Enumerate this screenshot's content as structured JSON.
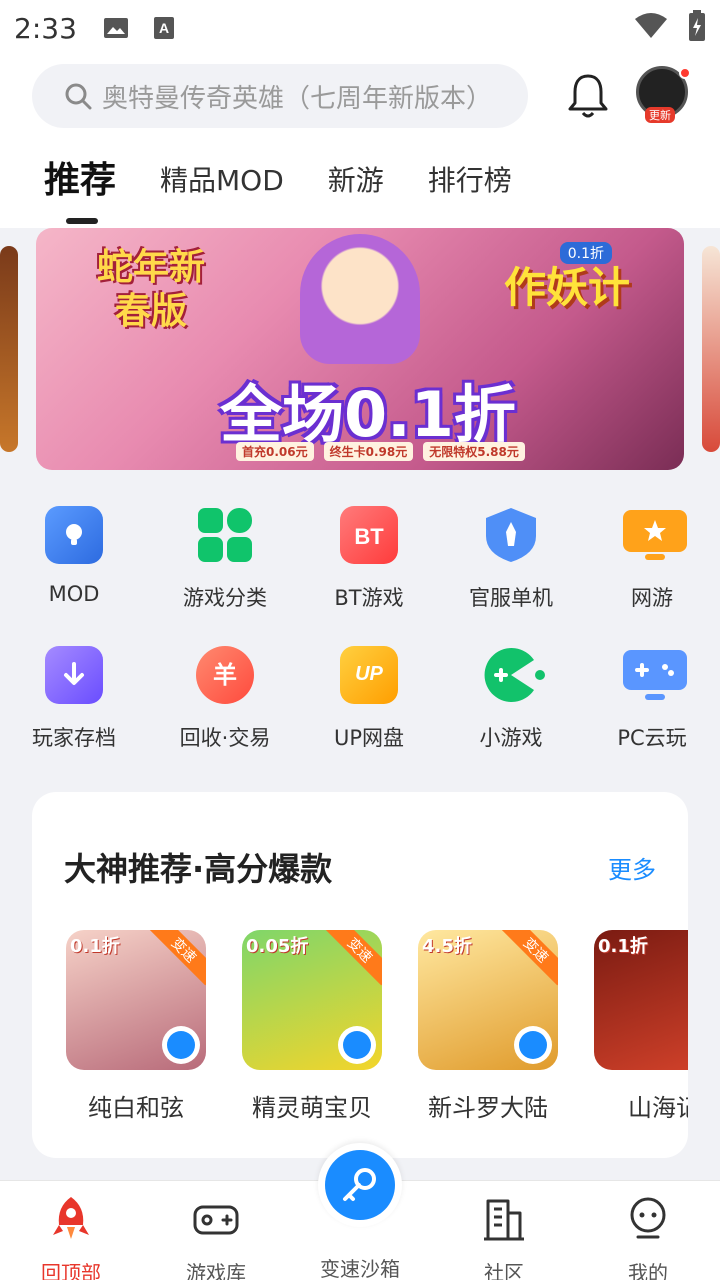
{
  "status_bar": {
    "time": "2:33"
  },
  "search": {
    "placeholder": "奥特曼传奇英雄（七周年新版本）"
  },
  "avatar": {
    "badge": "更新"
  },
  "tabs": [
    {
      "label": "推荐",
      "active": true
    },
    {
      "label": "精品MOD"
    },
    {
      "label": "新游"
    },
    {
      "label": "排行榜"
    }
  ],
  "banner": {
    "tag": "蛇年新春版",
    "logo": "作妖计",
    "logo_tag": "0.1折",
    "headline": "全场0.1折",
    "subs": [
      "首充0.06元",
      "终生卡0.98元",
      "无限特权5.88元"
    ]
  },
  "shortcuts": [
    {
      "label": "MOD",
      "icon": "mod-icon",
      "color": "#3b82f6"
    },
    {
      "label": "游戏分类",
      "icon": "category-icon",
      "color": "#10c46b"
    },
    {
      "label": "BT游戏",
      "icon": "bt-icon",
      "color": "#ff4d4f"
    },
    {
      "label": "官服单机",
      "icon": "shield-icon",
      "color": "#4f8ff7"
    },
    {
      "label": "网游",
      "icon": "star-screen-icon",
      "color": "#ffa21a"
    },
    {
      "label": "玩家存档",
      "icon": "save-icon",
      "color": "#7b61ff"
    },
    {
      "label": "回收·交易",
      "icon": "trade-icon",
      "color": "#ff5a4e"
    },
    {
      "label": "UP网盘",
      "icon": "cloud-disk-icon",
      "color": "#ffb300"
    },
    {
      "label": "小游戏",
      "icon": "pacman-icon",
      "color": "#12c26b"
    },
    {
      "label": "PC云玩",
      "icon": "gamepad-monitor-icon",
      "color": "#4f8ff7"
    }
  ],
  "section": {
    "title": "大神推荐·高分爆款",
    "more": "更多",
    "games": [
      {
        "name": "纯白和弦",
        "discount": "0.1折",
        "tag": "变速",
        "colors": [
          "#f6d2c8",
          "#b86b7a"
        ]
      },
      {
        "name": "精灵萌宝贝",
        "discount": "0.05折",
        "tag": "变速",
        "colors": [
          "#7fd66a",
          "#f3d52b"
        ]
      },
      {
        "name": "新斗罗大陆",
        "discount": "4.5折",
        "tag": "变速",
        "colors": [
          "#ffe8a0",
          "#e09b2c"
        ]
      },
      {
        "name": "山海记",
        "discount": "0.1折",
        "tag": "",
        "colors": [
          "#7a1b12",
          "#d5432b"
        ]
      }
    ]
  },
  "bottom_nav": [
    {
      "label": "回顶部",
      "active": true
    },
    {
      "label": "游戏库"
    },
    {
      "label": "变速沙箱"
    },
    {
      "label": "社区"
    },
    {
      "label": "我的"
    }
  ]
}
